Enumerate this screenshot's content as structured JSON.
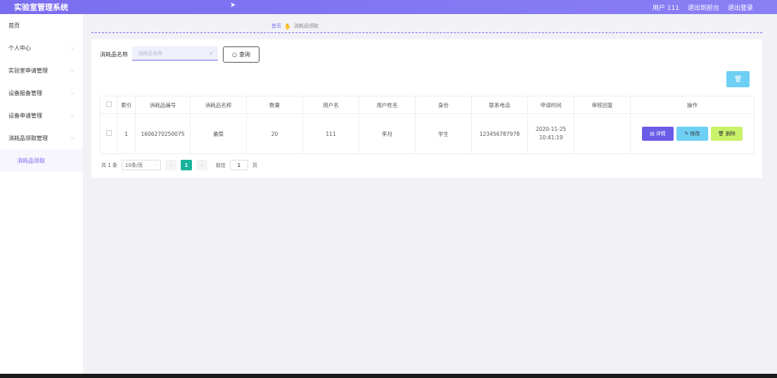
{
  "header": {
    "app_title": "实验室管理系统",
    "user_label": "用户 111",
    "back_label": "退出到前台",
    "logout_label": "退出登录"
  },
  "sidebar": {
    "items": [
      {
        "label": "首页",
        "expandable": false
      },
      {
        "label": "个人中心",
        "expandable": true
      },
      {
        "label": "实验室申请管理",
        "expandable": true
      },
      {
        "label": "设备报备管理",
        "expandable": true
      },
      {
        "label": "设备申请管理",
        "expandable": true
      },
      {
        "label": "消耗品领取管理",
        "expandable": true
      }
    ],
    "active_sub": "消耗品领取"
  },
  "breadcrumb": {
    "home": "首页",
    "current": "消耗品领取"
  },
  "search": {
    "label": "消耗品名称",
    "placeholder": "消耗品名称",
    "value": "",
    "query_label": "查询"
  },
  "table": {
    "headers": [
      "",
      "索引",
      "消耗品编号",
      "消耗品名称",
      "数量",
      "用户名",
      "用户姓名",
      "身份",
      "联系电话",
      "申请时间",
      "审核回复",
      "操作"
    ],
    "rows": [
      {
        "index": "1",
        "code": "1606270250075",
        "name": "量筒",
        "qty": "20",
        "username": "111",
        "realname": "李月",
        "role": "学生",
        "phone": "123456787978",
        "time": "2020-11-25 10:41:19",
        "reply": ""
      }
    ],
    "ops": {
      "detail": "详情",
      "edit": "修改",
      "delete": "删除"
    }
  },
  "pager": {
    "total": "共 1 条",
    "page_size": "10条/页",
    "current_page": "1",
    "goto_label": "前往",
    "goto_value": "1",
    "page_unit": "页"
  },
  "colors": {
    "accent": "#7a6df0",
    "detail": "#6b5ce7",
    "edit": "#6ecff4",
    "delete": "#c9f16a",
    "page_active": "#19b39a"
  }
}
